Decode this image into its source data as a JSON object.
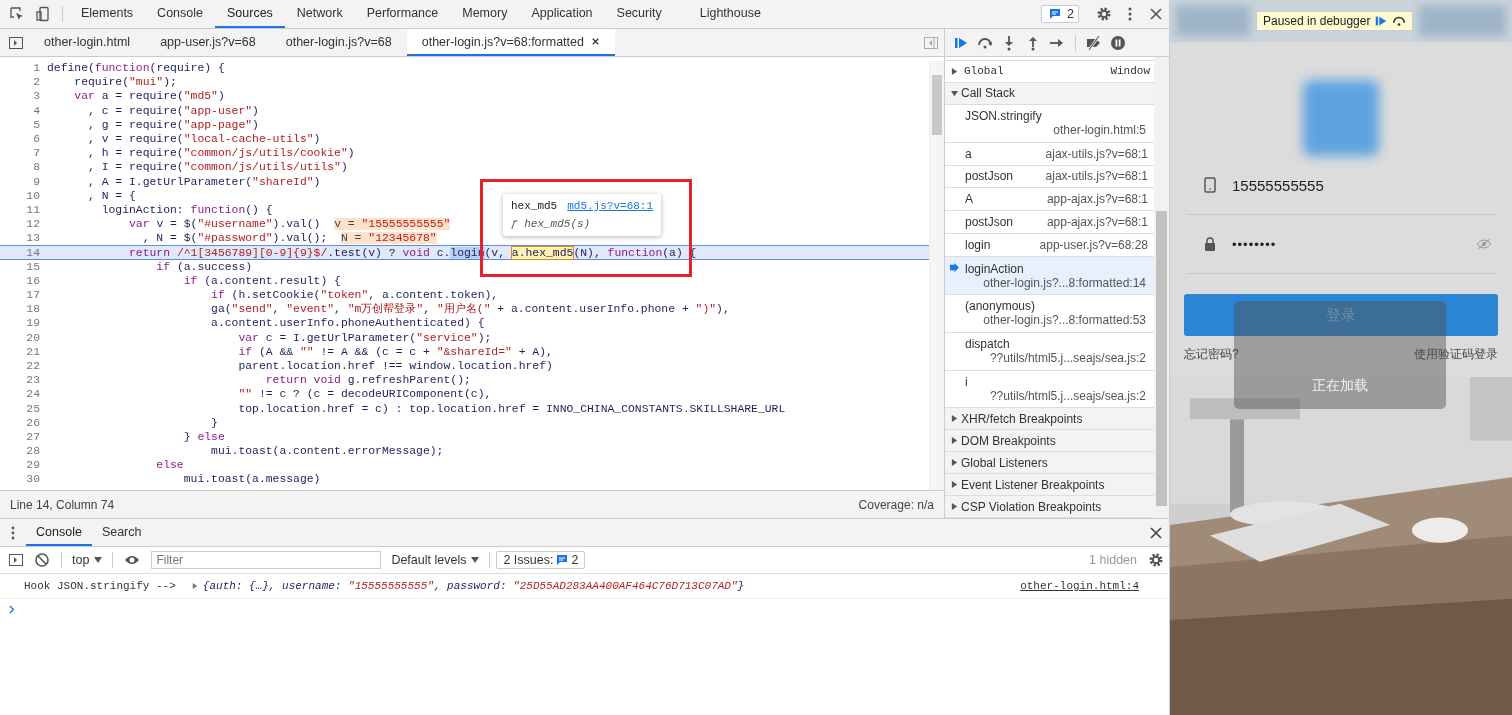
{
  "toolbar": {
    "tabs": [
      {
        "label": "Elements",
        "selected": false
      },
      {
        "label": "Console",
        "selected": false
      },
      {
        "label": "Sources",
        "selected": true
      },
      {
        "label": "Network",
        "selected": false
      },
      {
        "label": "Performance",
        "selected": false
      },
      {
        "label": "Memory",
        "selected": false
      },
      {
        "label": "Application",
        "selected": false
      },
      {
        "label": "Security",
        "selected": false
      },
      {
        "label": "Lighthouse",
        "selected": false
      }
    ],
    "issues_count": "2"
  },
  "editor": {
    "file_tabs": [
      {
        "label": "other-login.html",
        "selected": false,
        "closable": false
      },
      {
        "label": "app-user.js?v=68",
        "selected": false,
        "closable": false
      },
      {
        "label": "other-login.js?v=68",
        "selected": false,
        "closable": false
      },
      {
        "label": "other-login.js?v=68:formatted",
        "selected": true,
        "closable": true
      }
    ],
    "lines": [
      {
        "number": "1",
        "highlighted": false,
        "tokens": [
          {
            "kind": "plain",
            "text": "define("
          },
          {
            "kind": "keyword",
            "text": "function"
          },
          {
            "kind": "plain",
            "text": "(require) {"
          }
        ]
      },
      {
        "number": "2",
        "highlighted": false,
        "tokens": [
          {
            "kind": "plain",
            "text": "    require("
          },
          {
            "kind": "string",
            "text": "\"mui\""
          },
          {
            "kind": "plain",
            "text": ");"
          }
        ]
      },
      {
        "number": "3",
        "highlighted": false,
        "tokens": [
          {
            "kind": "keyword",
            "text": "    var"
          },
          {
            "kind": "plain",
            "text": " a = require("
          },
          {
            "kind": "string",
            "text": "\"md5\""
          },
          {
            "kind": "plain",
            "text": ")"
          }
        ]
      },
      {
        "number": "4",
        "highlighted": false,
        "tokens": [
          {
            "kind": "plain",
            "text": "      , c = require("
          },
          {
            "kind": "string",
            "text": "\"app-user\""
          },
          {
            "kind": "plain",
            "text": ")"
          }
        ]
      },
      {
        "number": "5",
        "highlighted": false,
        "tokens": [
          {
            "kind": "plain",
            "text": "      , g = require("
          },
          {
            "kind": "string",
            "text": "\"app-page\""
          },
          {
            "kind": "plain",
            "text": ")"
          }
        ]
      },
      {
        "number": "6",
        "highlighted": false,
        "tokens": [
          {
            "kind": "plain",
            "text": "      , v = require("
          },
          {
            "kind": "string",
            "text": "\"local-cache-utils\""
          },
          {
            "kind": "plain",
            "text": ")"
          }
        ]
      },
      {
        "number": "7",
        "highlighted": false,
        "tokens": [
          {
            "kind": "plain",
            "text": "      , h = require("
          },
          {
            "kind": "string",
            "text": "\"common/js/utils/cookie\""
          },
          {
            "kind": "plain",
            "text": ")"
          }
        ]
      },
      {
        "number": "8",
        "highlighted": false,
        "tokens": [
          {
            "kind": "plain",
            "text": "      , I = require("
          },
          {
            "kind": "string",
            "text": "\"common/js/utils/utils\""
          },
          {
            "kind": "plain",
            "text": ")"
          }
        ]
      },
      {
        "number": "9",
        "highlighted": false,
        "tokens": [
          {
            "kind": "plain",
            "text": "      , A = I.getUrlParameter("
          },
          {
            "kind": "string",
            "text": "\"shareId\""
          },
          {
            "kind": "plain",
            "text": ")"
          }
        ]
      },
      {
        "number": "10",
        "highlighted": false,
        "tokens": [
          {
            "kind": "plain",
            "text": "      , N = {"
          }
        ]
      },
      {
        "number": "11",
        "highlighted": false,
        "tokens": [
          {
            "kind": "plain",
            "text": "        loginAction: "
          },
          {
            "kind": "keyword",
            "text": "function"
          },
          {
            "kind": "plain",
            "text": "() {"
          }
        ]
      },
      {
        "number": "12",
        "highlighted": false,
        "tokens": [
          {
            "kind": "keyword",
            "text": "            var"
          },
          {
            "kind": "plain",
            "text": " v = $("
          },
          {
            "kind": "string",
            "text": "\"#username\""
          },
          {
            "kind": "plain",
            "text": ").val()  "
          },
          {
            "kind": "inline_name",
            "text": "v = "
          },
          {
            "kind": "inline_string",
            "text": "\"15555555555\""
          }
        ]
      },
      {
        "number": "13",
        "highlighted": false,
        "tokens": [
          {
            "kind": "plain",
            "text": "              , N = $("
          },
          {
            "kind": "string",
            "text": "\"#password\""
          },
          {
            "kind": "plain",
            "text": ").val();  "
          },
          {
            "kind": "inline_name",
            "text": "N = "
          },
          {
            "kind": "inline_string",
            "text": "\"12345678\""
          }
        ]
      },
      {
        "number": "14",
        "highlighted": true,
        "tokens": [
          {
            "kind": "keyword",
            "text": "            return"
          },
          {
            "kind": "string",
            "text": " /^1[3456789][0-9]{9}$/"
          },
          {
            "kind": "plain",
            "text": ".test(v) ? "
          },
          {
            "kind": "keyword",
            "text": "void"
          },
          {
            "kind": "plain",
            "text": " c."
          },
          {
            "kind": "selection",
            "text": "login"
          },
          {
            "kind": "plain",
            "text": "(v, "
          },
          {
            "kind": "hover",
            "text": "a.hex_md5"
          },
          {
            "kind": "plain",
            "text": "(N), "
          },
          {
            "kind": "keyword",
            "text": "function"
          },
          {
            "kind": "plain",
            "text": "(a) {"
          }
        ]
      },
      {
        "number": "15",
        "highlighted": false,
        "tokens": [
          {
            "kind": "keyword",
            "text": "                if"
          },
          {
            "kind": "plain",
            "text": " (a.success)"
          }
        ]
      },
      {
        "number": "16",
        "highlighted": false,
        "tokens": [
          {
            "kind": "keyword",
            "text": "                    if"
          },
          {
            "kind": "plain",
            "text": " (a.content.result) {"
          }
        ]
      },
      {
        "number": "17",
        "highlighted": false,
        "tokens": [
          {
            "kind": "keyword",
            "text": "                        if"
          },
          {
            "kind": "plain",
            "text": " (h.setCookie("
          },
          {
            "kind": "string",
            "text": "\"token\""
          },
          {
            "kind": "plain",
            "text": ", a.content.token),"
          }
        ]
      },
      {
        "number": "18",
        "highlighted": false,
        "tokens": [
          {
            "kind": "plain",
            "text": "                        ga("
          },
          {
            "kind": "string",
            "text": "\"send\""
          },
          {
            "kind": "plain",
            "text": ", "
          },
          {
            "kind": "string",
            "text": "\"event\""
          },
          {
            "kind": "plain",
            "text": ", "
          },
          {
            "kind": "string",
            "text": "\"m万创帮登录\""
          },
          {
            "kind": "plain",
            "text": ", "
          },
          {
            "kind": "string",
            "text": "\"用户名(\""
          },
          {
            "kind": "plain",
            "text": " + a.content.userInfo.phone + "
          },
          {
            "kind": "string",
            "text": "\")\""
          },
          {
            "kind": "plain",
            "text": "),"
          }
        ]
      },
      {
        "number": "19",
        "highlighted": false,
        "tokens": [
          {
            "kind": "plain",
            "text": "                        a.content.userInfo.phoneAuthenticated) {"
          }
        ]
      },
      {
        "number": "20",
        "highlighted": false,
        "tokens": [
          {
            "kind": "keyword",
            "text": "                            var"
          },
          {
            "kind": "plain",
            "text": " c = I.getUrlParameter("
          },
          {
            "kind": "string",
            "text": "\"service\""
          },
          {
            "kind": "plain",
            "text": ");"
          }
        ]
      },
      {
        "number": "21",
        "highlighted": false,
        "tokens": [
          {
            "kind": "keyword",
            "text": "                            if"
          },
          {
            "kind": "plain",
            "text": " (A && "
          },
          {
            "kind": "string",
            "text": "\"\""
          },
          {
            "kind": "plain",
            "text": " != A && (c = c + "
          },
          {
            "kind": "string",
            "text": "\"&shareId=\""
          },
          {
            "kind": "plain",
            "text": " + A),"
          }
        ]
      },
      {
        "number": "22",
        "highlighted": false,
        "tokens": [
          {
            "kind": "plain",
            "text": "                            parent.location.href !== window.location.href)"
          }
        ]
      },
      {
        "number": "23",
        "highlighted": false,
        "tokens": [
          {
            "kind": "keyword",
            "text": "                                return void"
          },
          {
            "kind": "plain",
            "text": " g.refreshParent();"
          }
        ]
      },
      {
        "number": "24",
        "highlighted": false,
        "tokens": [
          {
            "kind": "string",
            "text": "                            \"\""
          },
          {
            "kind": "plain",
            "text": " != c ? (c = decodeURIComponent(c),"
          }
        ]
      },
      {
        "number": "25",
        "highlighted": false,
        "tokens": [
          {
            "kind": "plain",
            "text": "                            top.location.href = c) : top.location.href = INNO_CHINA_CONSTANTS.SKILLSHARE_URL"
          }
        ]
      },
      {
        "number": "26",
        "highlighted": false,
        "tokens": [
          {
            "kind": "plain",
            "text": "                        }"
          }
        ]
      },
      {
        "number": "27",
        "highlighted": false,
        "tokens": [
          {
            "kind": "plain",
            "text": "                    } "
          },
          {
            "kind": "keyword",
            "text": "else"
          }
        ]
      },
      {
        "number": "28",
        "highlighted": false,
        "tokens": [
          {
            "kind": "plain",
            "text": "                        mui.toast(a.content.errorMessage);"
          }
        ]
      },
      {
        "number": "29",
        "highlighted": false,
        "tokens": [
          {
            "kind": "keyword",
            "text": "                else"
          }
        ]
      },
      {
        "number": "30",
        "highlighted": false,
        "tokens": [
          {
            "kind": "plain",
            "text": "                    mui.toast(a.message)"
          }
        ]
      }
    ],
    "tooltip": {
      "name": "hex_md5",
      "link": "md5.js?v=68:1",
      "signature": "ƒ hex_md5(s)"
    },
    "status": {
      "position": "Line 14, Column 74",
      "coverage": "Coverage: n/a"
    }
  },
  "debugger": {
    "scope": [
      {
        "name": "Global",
        "value": "Window"
      }
    ],
    "call_stack": {
      "title": "Call Stack",
      "expanded": true,
      "frames": [
        {
          "function": "JSON.stringify",
          "location": "other-login.html:5",
          "kind": "stacked",
          "selected": false
        },
        {
          "function": "a",
          "location": "ajax-utils.js?v=68:1",
          "kind": "inline",
          "selected": false
        },
        {
          "function": "postJson",
          "location": "ajax-utils.js?v=68:1",
          "kind": "inline",
          "selected": false
        },
        {
          "function": "A",
          "location": "app-ajax.js?v=68:1",
          "kind": "inline",
          "selected": false
        },
        {
          "function": "postJson",
          "location": "app-ajax.js?v=68:1",
          "kind": "inline",
          "selected": false
        },
        {
          "function": "login",
          "location": "app-user.js?v=68:28",
          "kind": "inline",
          "selected": false
        },
        {
          "function": "loginAction",
          "location": "other-login.js?...8:formatted:14",
          "kind": "stacked",
          "selected": true
        },
        {
          "function": "(anonymous)",
          "location": "other-login.js?...8:formatted:53",
          "kind": "stacked",
          "selected": false
        },
        {
          "function": "dispatch",
          "location": "??utils/html5.j...seajs/sea.js:2",
          "kind": "stacked",
          "selected": false
        },
        {
          "function": "i",
          "location": "??utils/html5.j...seajs/sea.js:2",
          "kind": "stacked",
          "selected": false
        }
      ]
    },
    "sections": [
      {
        "title": "XHR/fetch Breakpoints",
        "expanded": false
      },
      {
        "title": "DOM Breakpoints",
        "expanded": false
      },
      {
        "title": "Global Listeners",
        "expanded": false
      },
      {
        "title": "Event Listener Breakpoints",
        "expanded": false
      },
      {
        "title": "CSP Violation Breakpoints",
        "expanded": false
      }
    ]
  },
  "drawer": {
    "tabs": [
      {
        "label": "Console",
        "selected": true
      },
      {
        "label": "Search",
        "selected": false
      }
    ],
    "context": "top",
    "filter_placeholder": "Filter",
    "levels": "Default levels",
    "issues_label": "2 Issues:",
    "issues_count": "2",
    "hidden": "1 hidden",
    "messages": [
      {
        "text": "Hook JSON.stringify -->",
        "preview": [
          {
            "kind": "plain",
            "text": "{auth: {…}, username: "
          },
          {
            "kind": "string",
            "text": "\"15555555555\""
          },
          {
            "kind": "plain",
            "text": ", password: "
          },
          {
            "kind": "string",
            "text": "\"25D55AD283AA400AF464C76D713C07AD\""
          },
          {
            "kind": "plain",
            "text": "}"
          }
        ],
        "source": "other-login.html:4"
      }
    ]
  },
  "app": {
    "debugger_badge": "Paused in debugger",
    "phone": "15555555555",
    "password": "••••••••",
    "login_button": "登录",
    "forgot": "忘记密码?",
    "sms_login": "使用验证码登录",
    "loading": "正在加载"
  }
}
